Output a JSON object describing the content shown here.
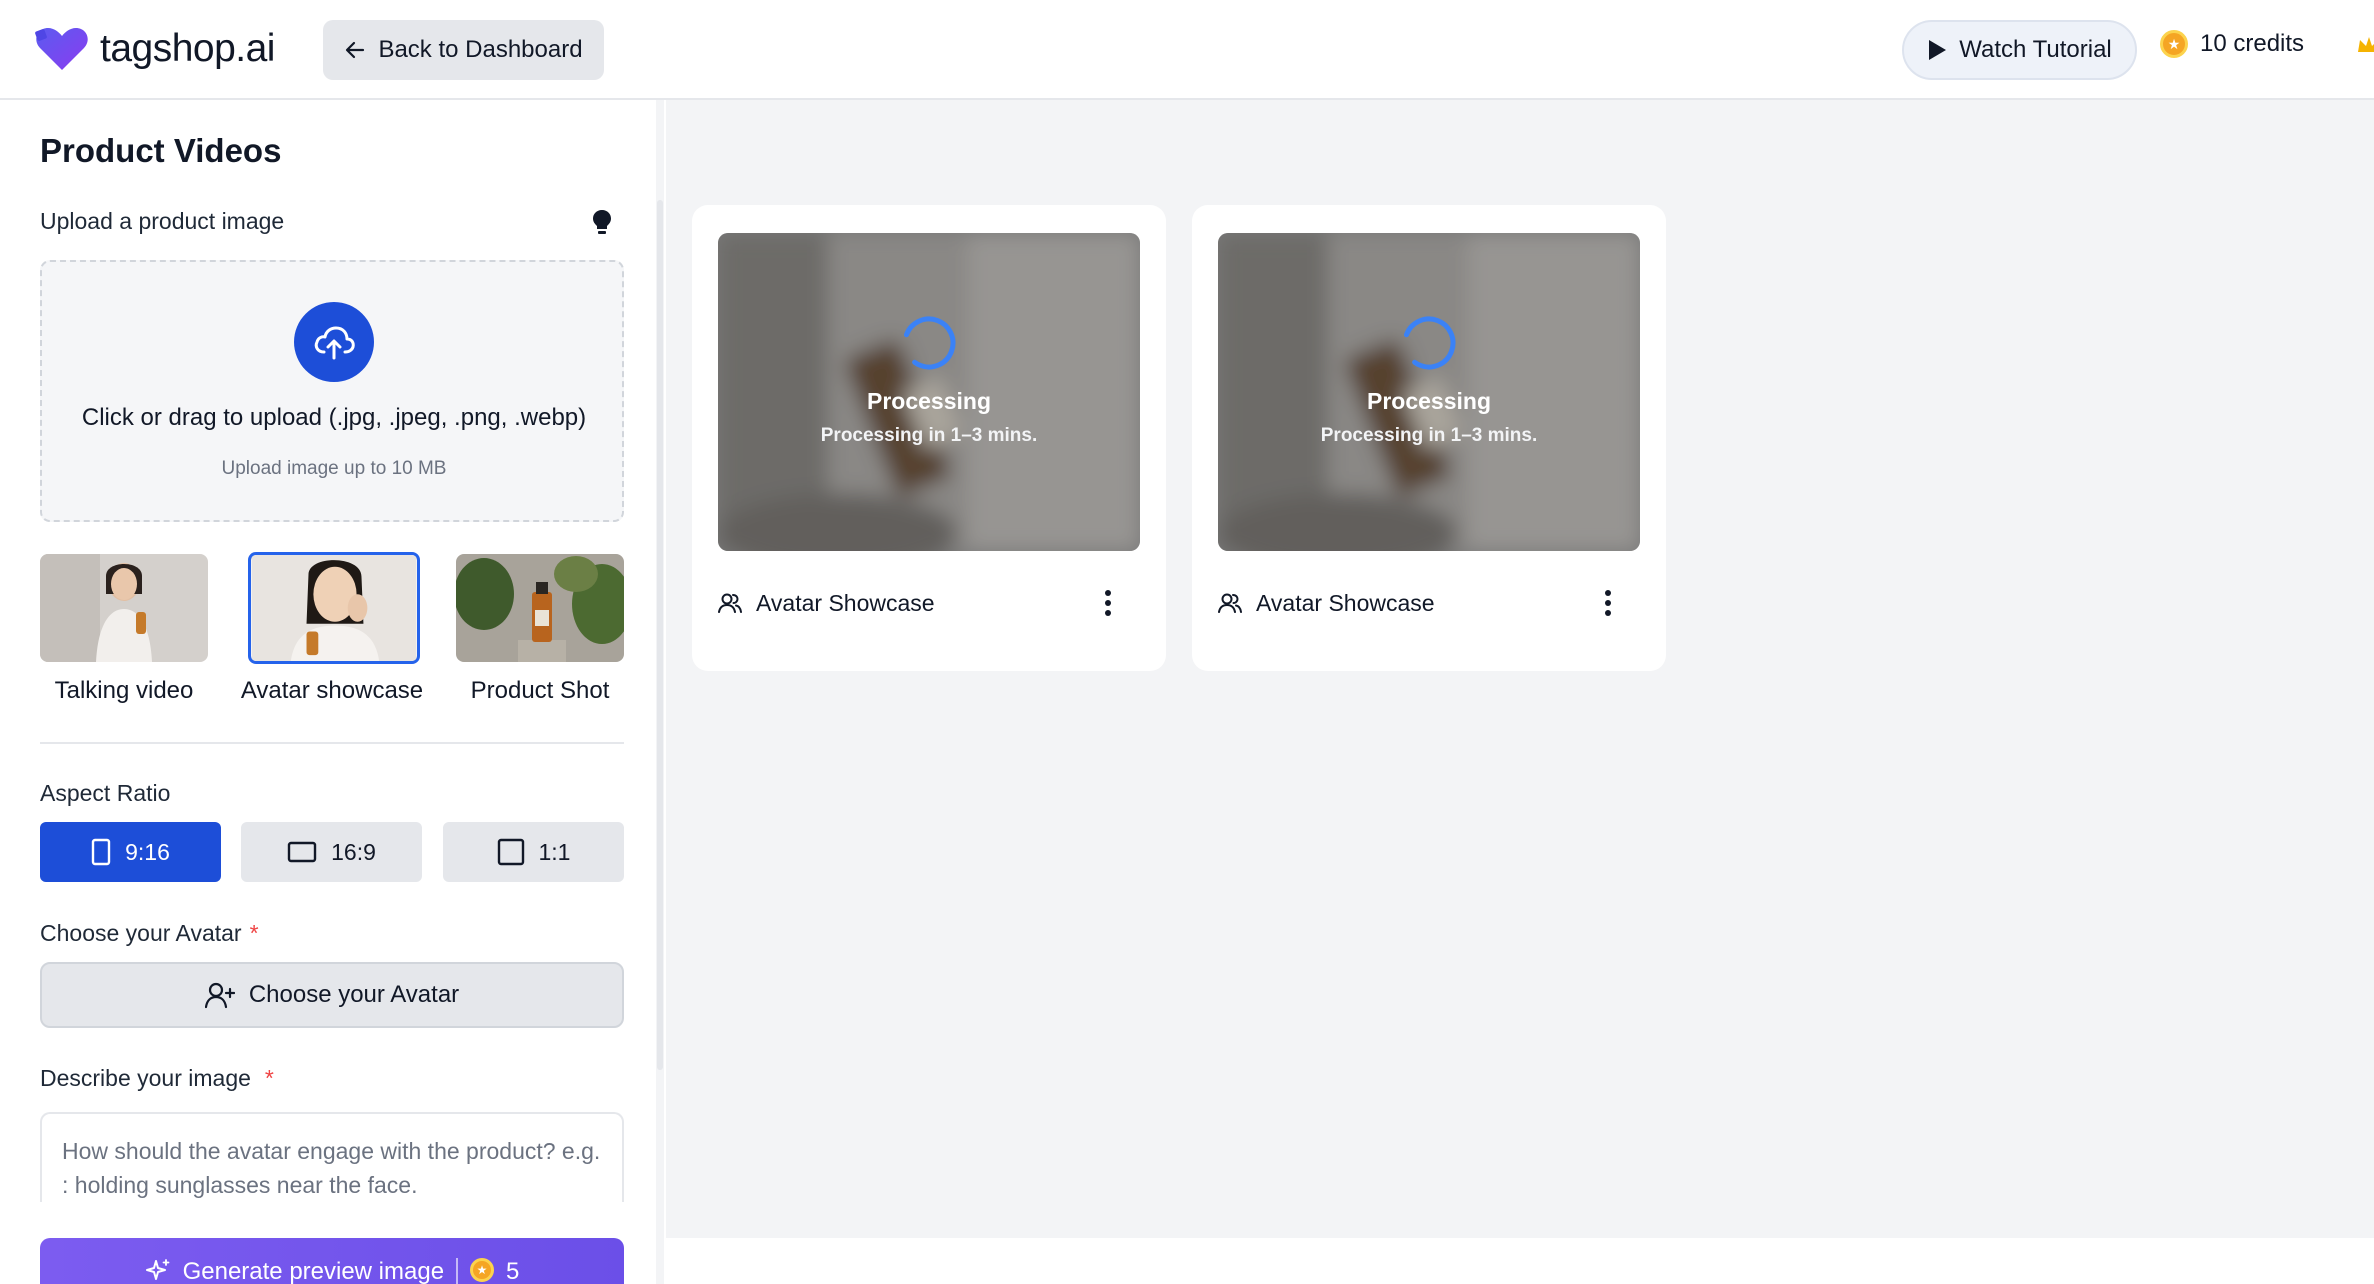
{
  "header": {
    "brand": "tagshop.ai",
    "back_label": "Back to Dashboard",
    "watch_label": "Watch Tutorial",
    "credits_label": "10 credits"
  },
  "sidebar": {
    "title": "Product Videos",
    "upload_label": "Upload a product image",
    "upload_main": "Click or drag to upload (.jpg, .jpeg, .png, .webp)",
    "upload_sub": "Upload image up to 10 MB",
    "styles": [
      {
        "label": "Talking video",
        "selected": false
      },
      {
        "label": "Avatar showcase",
        "selected": true
      },
      {
        "label": "Product Shot",
        "selected": false
      }
    ],
    "aspect_label": "Aspect Ratio",
    "ratios": [
      {
        "label": "9:16",
        "selected": true
      },
      {
        "label": "16:9",
        "selected": false
      },
      {
        "label": "1:1",
        "selected": false
      }
    ],
    "avatar_label": "Choose your Avatar",
    "required_mark": "*",
    "avatar_button": "Choose your Avatar",
    "describe_label": "Describe your image",
    "describe_placeholder": "How should the avatar engage with the product? e.g. : holding sunglasses near the face.",
    "generate_label": "Generate preview image",
    "generate_cost": "5"
  },
  "cards": [
    {
      "status": "Processing",
      "eta": "Processing in 1–3 mins.",
      "name": "Avatar Showcase"
    },
    {
      "status": "Processing",
      "eta": "Processing in 1–3 mins.",
      "name": "Avatar Showcase"
    }
  ],
  "colors": {
    "accent": "#1d4ed8",
    "generate": "#7c5cf0",
    "required": "#ef4444",
    "coin": "#f5a524"
  }
}
